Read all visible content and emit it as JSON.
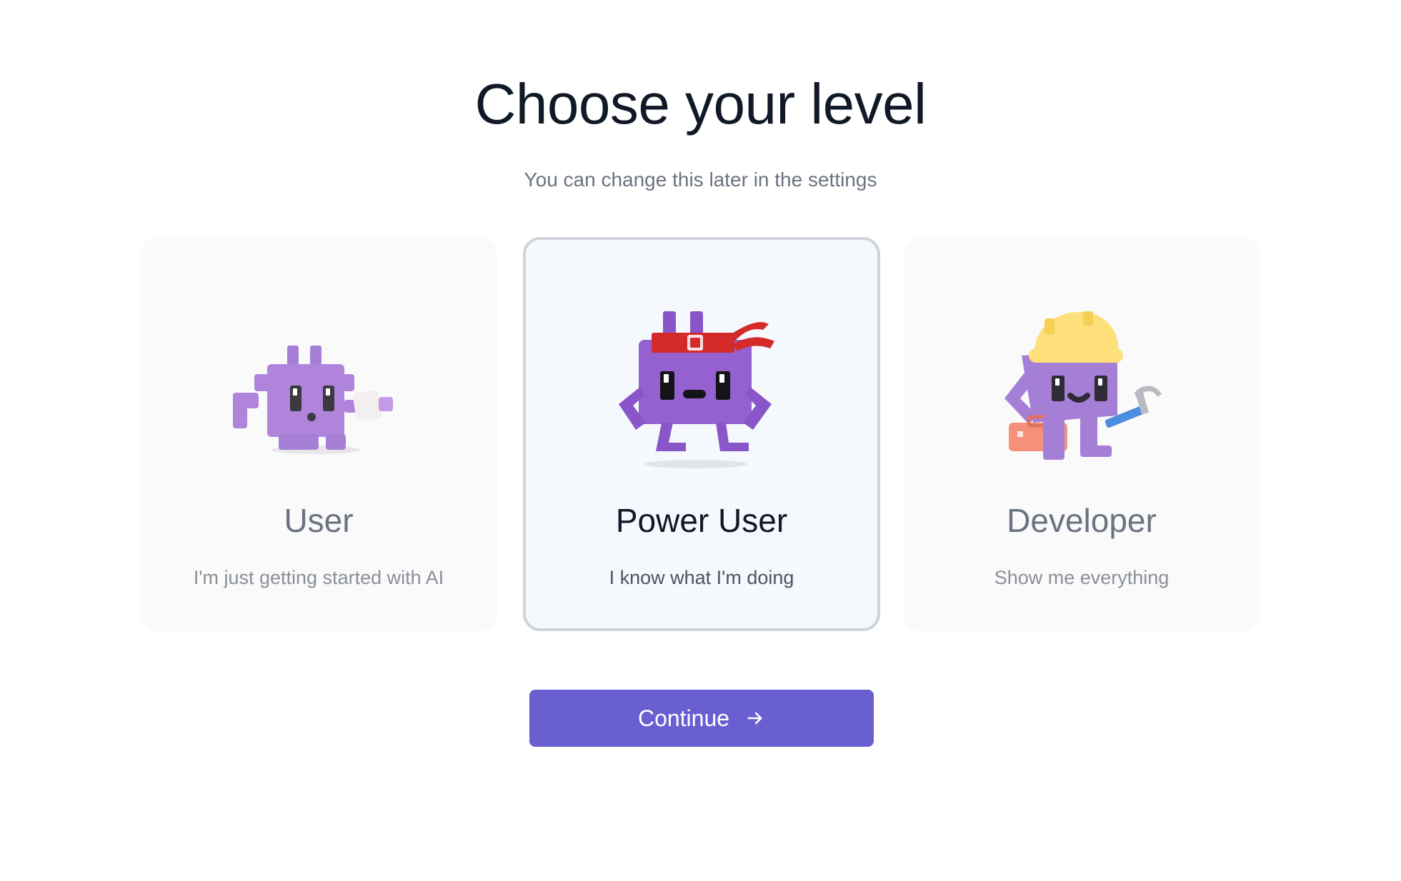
{
  "header": {
    "title": "Choose your level",
    "subtitle": "You can change this later in the settings"
  },
  "levels": [
    {
      "name": "User",
      "description": "I'm just getting started with AI",
      "icon": "purple-critter-icon",
      "selected": false
    },
    {
      "name": "Power User",
      "description": "I know what I'm doing",
      "icon": "headband-critter-icon",
      "selected": true
    },
    {
      "name": "Developer",
      "description": "Show me everything",
      "icon": "hardhat-critter-icon",
      "selected": false
    }
  ],
  "actions": {
    "continue_label": "Continue",
    "continue_icon": "arrow-right-icon"
  },
  "colors": {
    "accent": "#6a5fd1",
    "critter_purple": "#a57fd6",
    "critter_dark_purple": "#8a55c9",
    "headband_red": "#d42a2a",
    "hardhat_yellow": "#fde07a",
    "selected_border": "#cfd4da",
    "selected_bg": "#f5f8fc"
  }
}
